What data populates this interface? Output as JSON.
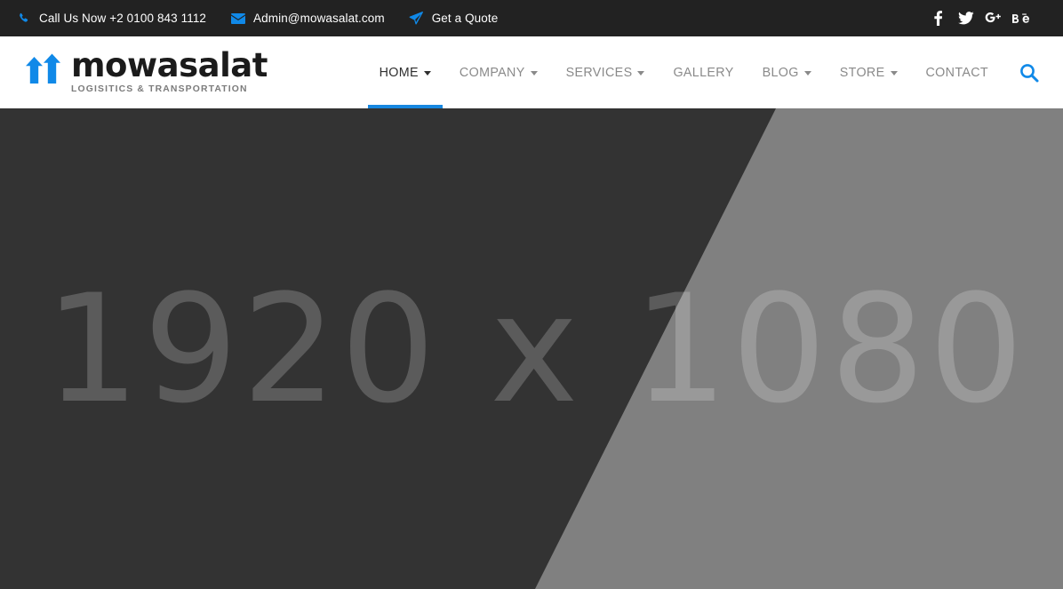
{
  "colors": {
    "accent": "#1089e8",
    "accent_underline": "#1787e0",
    "topbar_bg": "#222222",
    "header_bg": "#ffffff",
    "hero_dark": "#333333",
    "hero_light": "#808080",
    "nav_text": "#8a8a8a",
    "nav_active_text": "#2f2f2f",
    "logo_text": "#1b1b1b",
    "logo_tagline": "#7b7b7b"
  },
  "topbar": {
    "links": [
      {
        "icon": "phone-icon",
        "label": "Call Us Now +2 0100 843 1112"
      },
      {
        "icon": "envelope-icon",
        "label": "Admin@mowasalat.com"
      },
      {
        "icon": "paper-plane-icon",
        "label": "Get a Quote"
      }
    ],
    "social": [
      {
        "name": "facebook-icon",
        "label": "f"
      },
      {
        "name": "twitter-icon",
        "label": "Twitter"
      },
      {
        "name": "google-plus-icon",
        "label": "g+"
      },
      {
        "name": "behance-icon",
        "label": "Bē"
      }
    ]
  },
  "header": {
    "logo": {
      "name": "mowasalat",
      "tagline": "LOGISITICS & TRANSPORTATION",
      "icon": "double-up-arrow-icon"
    },
    "nav": [
      {
        "label": "HOME",
        "has_dropdown": true,
        "active": true
      },
      {
        "label": "COMPANY",
        "has_dropdown": true,
        "active": false
      },
      {
        "label": "SERVICES",
        "has_dropdown": true,
        "active": false
      },
      {
        "label": "GALLERY",
        "has_dropdown": false,
        "active": false
      },
      {
        "label": "BLOG",
        "has_dropdown": true,
        "active": false
      },
      {
        "label": "STORE",
        "has_dropdown": true,
        "active": false
      },
      {
        "label": "CONTACT",
        "has_dropdown": false,
        "active": false
      }
    ],
    "search_icon": "search-icon"
  },
  "hero": {
    "placeholder_text": "1920 x 1080"
  }
}
